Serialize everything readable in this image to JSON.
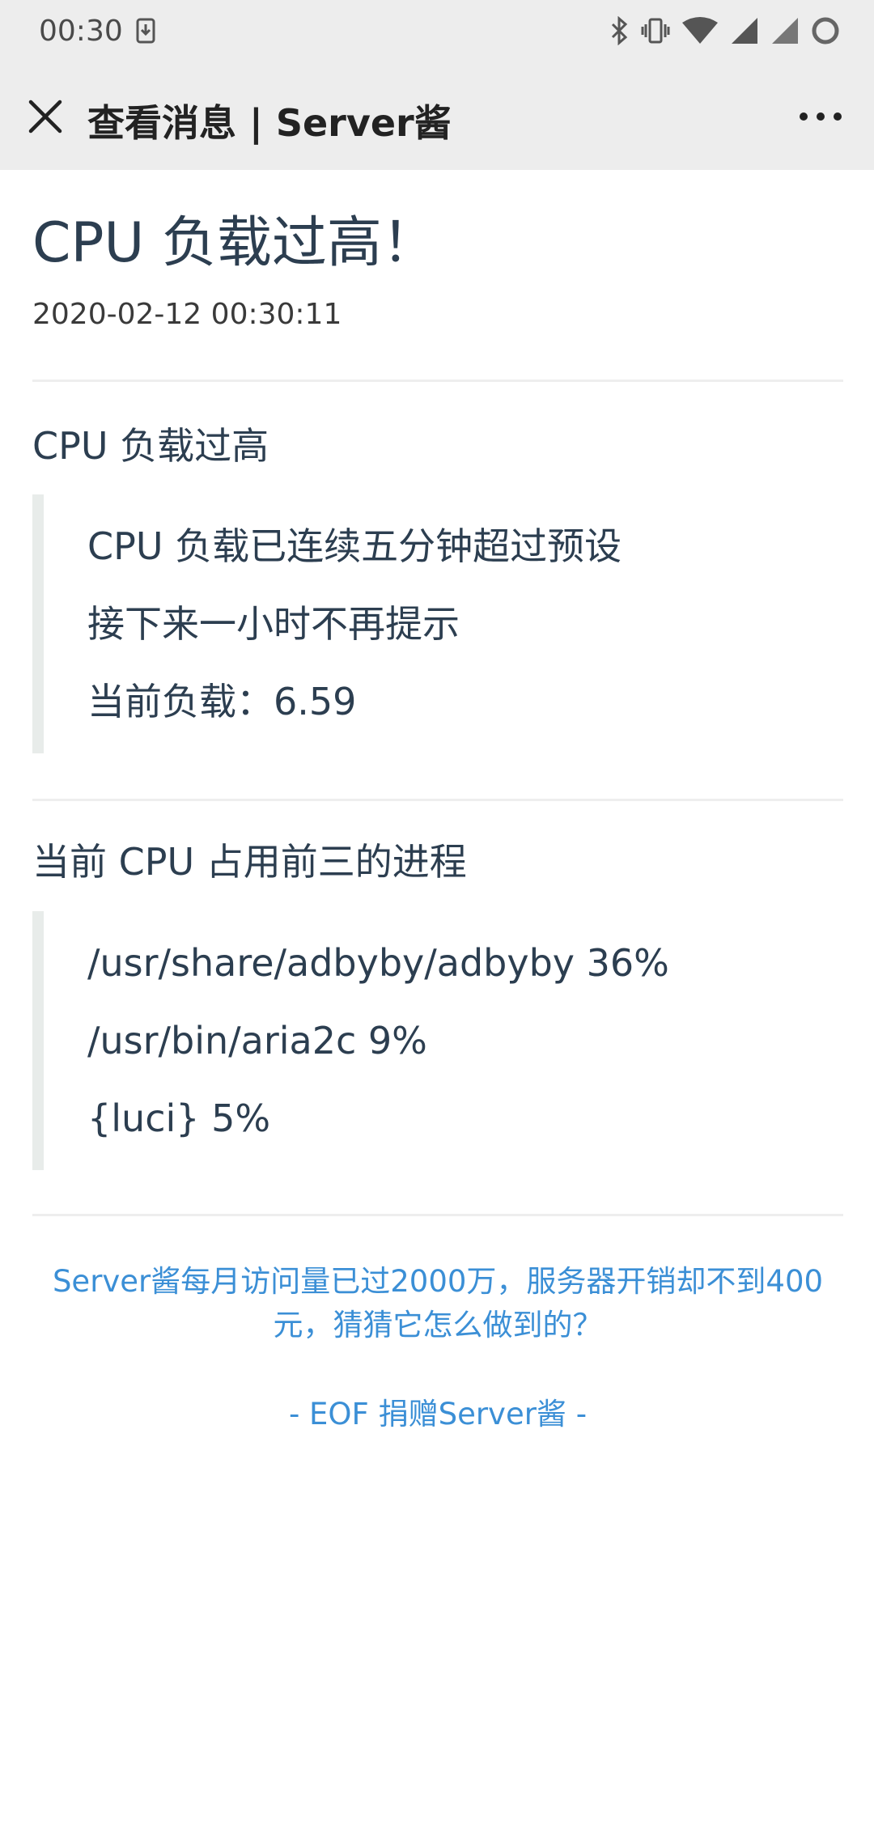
{
  "status_bar": {
    "time": "00:30",
    "icons": [
      "download-icon",
      "bluetooth-icon",
      "vibrate-icon",
      "wifi-icon",
      "signal-icon",
      "signal-icon-2",
      "battery-ring-icon"
    ]
  },
  "nav": {
    "title": "查看消息 | Server酱",
    "close_icon": "close-icon",
    "more_icon": "more-icon"
  },
  "message": {
    "title": "CPU 负载过高！",
    "time": "2020-02-12 00:30:11",
    "section1": {
      "heading": "CPU 负载过高",
      "lines": [
        "CPU 负载已连续五分钟超过预设",
        "接下来一小时不再提示",
        "当前负载：6.59"
      ]
    },
    "section2": {
      "heading": "当前 CPU 占用前三的进程",
      "lines": [
        "/usr/share/adbyby/adbyby 36%",
        "/usr/bin/aria2c 9%",
        "{luci} 5%"
      ]
    }
  },
  "footer": {
    "promo": "Server酱每月访问量已过2000万，服务器开销却不到400元，猜猜它怎么做到的？",
    "eof": "- EOF 捐赠Server酱 -"
  },
  "colors": {
    "bar_bg": "#ededed",
    "heading": "#2c3e50",
    "link": "#3b8fd6",
    "quote_border": "#e8ecea"
  }
}
